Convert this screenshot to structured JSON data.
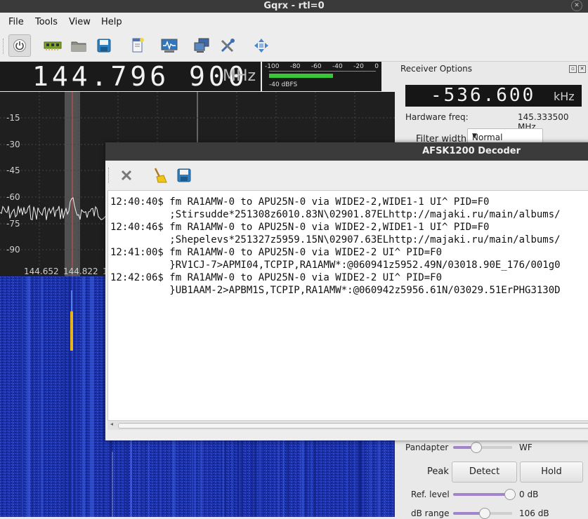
{
  "window": {
    "title": "Gqrx  - rtl=0"
  },
  "menu": [
    "File",
    "Tools",
    "View",
    "Help"
  ],
  "toolbar_icons": [
    "power-icon",
    "device-icon",
    "open-folder-icon",
    "save-icon",
    "note-icon",
    "scope-icon",
    "network-icon",
    "tools-icon",
    "move-icon"
  ],
  "frequency": {
    "value": "144.796 900",
    "unit": "MHz"
  },
  "signal_meter": {
    "ticks": [
      "-100",
      "-80",
      "-60",
      "-40",
      "-20",
      "0"
    ],
    "level_dbfs": -40,
    "label": "-40 dBFS",
    "fill_color": "#37c837"
  },
  "spectrum": {
    "y_ticks": [
      "-15",
      "-30",
      "-45",
      "-60",
      "-75",
      "-90"
    ],
    "x_ticks": [
      "144.652",
      "144.822",
      "1"
    ]
  },
  "receiver": {
    "title": "Receiver Options",
    "offset": {
      "value": "-536.600",
      "unit": "kHz"
    },
    "hw_freq_label": "Hardware freq:",
    "hw_freq_value": "145.333500 MHz",
    "filter_label": "Filter width",
    "filter_value": "Normal"
  },
  "fft": {
    "pandapter_label": "Pandapter",
    "wf_label": "WF",
    "pandapter_split": 0.38,
    "peak_label": "Peak",
    "detect_label": "Detect",
    "hold_label": "Hold",
    "ref_level_label": "Ref. level",
    "ref_level_value": "0 dB",
    "ref_level_fraction": 0.95,
    "db_range_label": "dB range",
    "db_range_value": "106 dB",
    "db_range_fraction": 0.52
  },
  "decoder": {
    "title": "AFSK1200 Decoder",
    "toolbar_icons": [
      "clear-icon",
      "broom-icon",
      "save-icon"
    ],
    "log": [
      "12:40:40$ fm RA1AMW-0 to APU25N-0 via WIDE2-2,WIDE1-1 UI^ PID=F0",
      "          ;Stirsudde*251308z6010.83N\\02901.87ELhttp://majaki.ru/main/albums/",
      "12:40:46$ fm RA1AMW-0 to APU25N-0 via WIDE2-2,WIDE1-1 UI^ PID=F0",
      "          ;Shepelevs*251327z5959.15N\\02907.63ELhttp://majaki.ru/main/albums/",
      "12:41:00$ fm RA1AMW-0 to APU25N-0 via WIDE2-2 UI^ PID=F0",
      "          }RV1CJ-7>APMI04,TCPIP,RA1AMW*:@060941z5952.49N/03018.90E_176/001g0",
      "12:42:06$ fm RA1AMW-0 to APU25N-0 via WIDE2-2 UI^ PID=F0",
      "          }UB1AAM-2>APBM1S,TCPIP,RA1AMW*:@060942z5956.61N/03029.51ErPHG3130D"
    ]
  }
}
